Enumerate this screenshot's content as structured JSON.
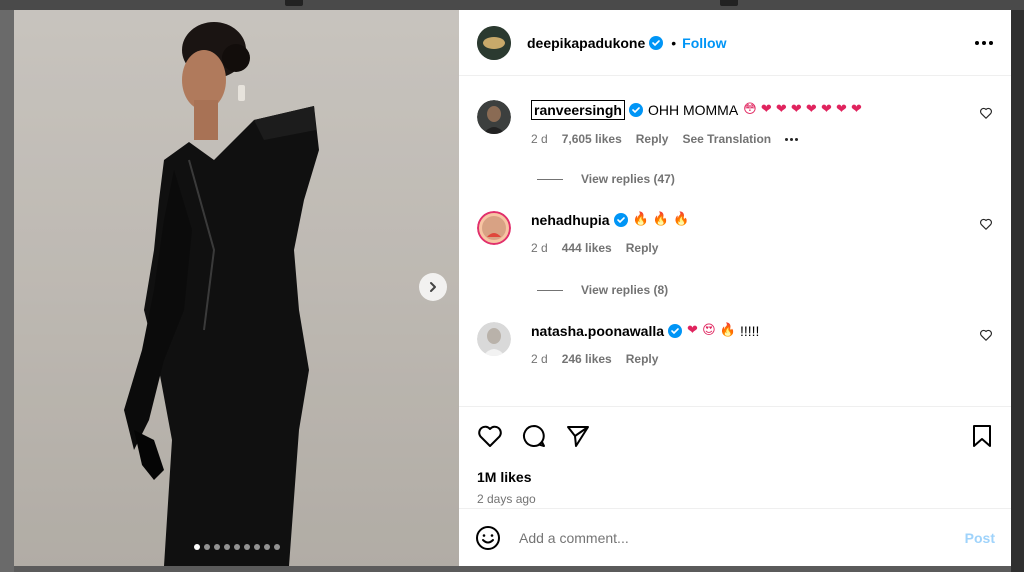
{
  "post": {
    "owner": "deepikapadukone",
    "separator": "•",
    "follow_label": "Follow",
    "likes": "1M likes",
    "time_ago": "2 days ago",
    "carousel_dots": 9,
    "active_dot": 0
  },
  "comments": [
    {
      "user": "ranveersingh",
      "text": "OHH MOMMA",
      "emojis": "😳 ❤ ❤ ❤ ❤ ❤ ❤ ❤",
      "time": "2 d",
      "likes": "7,605 likes",
      "reply": "Reply",
      "translate": "See Translation",
      "view_replies": "View replies (47)"
    },
    {
      "user": "nehadhupia",
      "text": "",
      "emojis": "🔥 🔥 🔥",
      "time": "2 d",
      "likes": "444 likes",
      "reply": "Reply",
      "view_replies": "View replies (8)"
    },
    {
      "user": "natasha.poonawalla",
      "text": "!!!!!",
      "emojis": "❤ 😍 🔥",
      "time": "2 d",
      "likes": "246 likes",
      "reply": "Reply"
    }
  ],
  "composer": {
    "placeholder": "Add a comment...",
    "post_label": "Post"
  },
  "colors": {
    "accent": "#0095f6",
    "muted": "#737373",
    "post_disabled": "#9fd3fb",
    "heart": "#e0245e"
  },
  "icons": [
    "verified-badge-icon",
    "more-options-icon",
    "heart-icon",
    "comment-icon",
    "share-icon",
    "bookmark-icon",
    "emoji-icon",
    "chevron-right-icon"
  ]
}
